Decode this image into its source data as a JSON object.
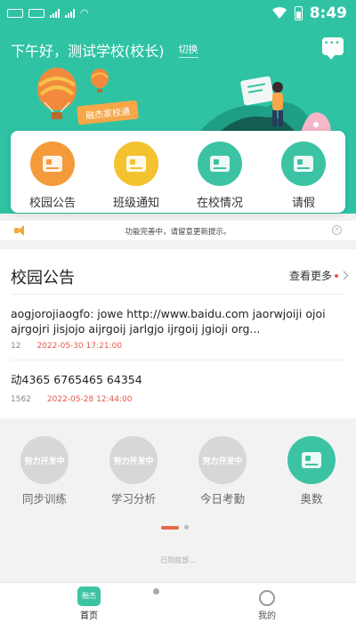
{
  "status_bar": {
    "time": "8:49"
  },
  "header": {
    "greeting": "下午好，测试学校(校长)",
    "switch_label": "切换",
    "banner_tag": "融杰家校通"
  },
  "quick_actions": [
    {
      "label": "校园公告"
    },
    {
      "label": "班级通知"
    },
    {
      "label": "在校情况"
    },
    {
      "label": "请假"
    }
  ],
  "notice": {
    "text": "功能完善中，请留意更新提示。"
  },
  "announcements": {
    "title": "校园公告",
    "more_label": "查看更多",
    "items": [
      {
        "title": "aogjorojiaogfo: jowe http://www.baidu.com jaorwjoiji ojoi ajrgojri jisjojo aijrgoij jarlgjo ijrgoij jgioji org...",
        "count": "12",
        "date": "2022-05-30 17:21:00"
      },
      {
        "title": "动4365 6765465 64354",
        "count": "1562",
        "date": "2022-05-28 12:44:00"
      }
    ]
  },
  "features": [
    {
      "icon_text": "努力开发中",
      "label": "同步训练"
    },
    {
      "icon_text": "努力开发中",
      "label": "学习分析"
    },
    {
      "icon_text": "努力开发中",
      "label": "今日考勤"
    },
    {
      "icon_text": "",
      "label": "奥数"
    }
  ],
  "footer_note": "已到底部...",
  "tabbar": {
    "home_icon_text": "融杰",
    "home_label": "首页",
    "mine_label": "我的"
  },
  "colors": {
    "primary": "#2fc3a4",
    "accent_orange": "#f59a3a",
    "date_red": "#e35a4a"
  }
}
